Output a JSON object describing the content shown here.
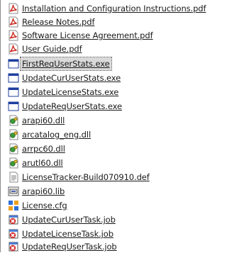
{
  "files": [
    {
      "name": "Installation and Configuration Instructions.pdf",
      "icon": "pdf-icon"
    },
    {
      "name": "Release Notes.pdf",
      "icon": "pdf-icon"
    },
    {
      "name": "Software License Agreement.pdf",
      "icon": "pdf-icon"
    },
    {
      "name": "User Guide.pdf",
      "icon": "pdf-icon"
    },
    {
      "name": "FirstReqUserStats.exe",
      "icon": "exe-icon",
      "selected": true
    },
    {
      "name": "UpdateCurUserStats.exe",
      "icon": "exe-icon"
    },
    {
      "name": "UpdateLicenseStats.exe",
      "icon": "exe-icon"
    },
    {
      "name": "UpdateReqUserStats.exe",
      "icon": "exe-icon"
    },
    {
      "name": "arapi60.dll",
      "icon": "dll-icon"
    },
    {
      "name": "arcatalog_eng.dll",
      "icon": "dll-icon"
    },
    {
      "name": "arrpc60.dll",
      "icon": "dll-icon"
    },
    {
      "name": "arutl60.dll",
      "icon": "dll-icon"
    },
    {
      "name": "LicenseTracker-Build070910.def",
      "icon": "def-icon"
    },
    {
      "name": "arapi60.lib",
      "icon": "lib-icon"
    },
    {
      "name": "License.cfg",
      "icon": "cfg-icon"
    },
    {
      "name": "UpdateCurUserTask.job",
      "icon": "job-icon"
    },
    {
      "name": "UpdateLicenseTask.job",
      "icon": "job-icon"
    },
    {
      "name": "UpdateReqUserTask.job",
      "icon": "job-icon"
    }
  ],
  "colors": {
    "pdf": "#cc2b1f",
    "exe": "#1f3f9e",
    "dll": "#3a9e3a",
    "job": "#d22b2b",
    "selection": "#d9d9d9"
  }
}
